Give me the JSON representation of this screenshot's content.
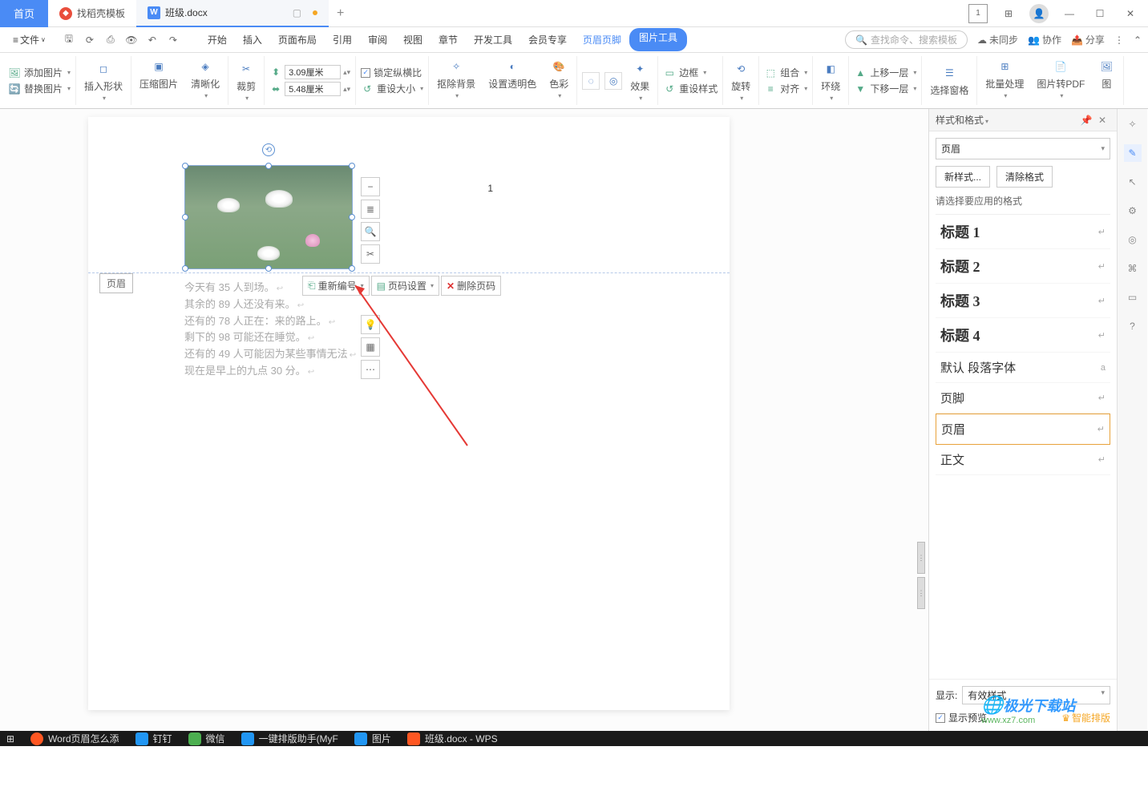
{
  "titlebar": {
    "home": "首页",
    "template": "找稻壳模板",
    "doc": "班级.docx",
    "add": "+"
  },
  "menubar": {
    "file": "文件",
    "tabs": [
      "开始",
      "插入",
      "页面布局",
      "引用",
      "审阅",
      "视图",
      "章节",
      "开发工具",
      "会员专享"
    ],
    "context1": "页眉页脚",
    "context2": "图片工具",
    "search_ph": "查找命令、搜索模板",
    "unsync": "未同步",
    "collab": "协作",
    "share": "分享"
  },
  "ribbon": {
    "add_pic": "添加图片",
    "replace_pic": "替换图片",
    "insert_shape": "插入形状",
    "compress": "压缩图片",
    "clarity": "清晰化",
    "crop": "裁剪",
    "height": "3.09厘米",
    "width": "5.48厘米",
    "lock_ratio": "锁定纵横比",
    "reset_size": "重设大小",
    "remove_bg": "抠除背景",
    "set_transparent": "设置透明色",
    "color": "色彩",
    "effect": "效果",
    "border": "边框",
    "reset_style": "重设样式",
    "rotate": "旋转",
    "group": "组合",
    "align": "对齐",
    "wrap": "环绕",
    "move_up": "上移一层",
    "move_down": "下移一层",
    "sel_pane": "选择窗格",
    "batch": "批量处理",
    "to_pdf": "图片转PDF",
    "pic_trunc": "图"
  },
  "doc": {
    "pagenum": "1",
    "header_label": "页眉",
    "lines": [
      "今天有 35 人到场。",
      "其余的 89 人还没有来。",
      "还有的 78 人正在：来的路上。",
      "剩下的 98 可能还在睡觉。",
      "还有的 49 人可能因为某些事情无法",
      "现在是早上的九点 30 分。"
    ],
    "ctx": {
      "renumber": "重新编号",
      "page_setup": "页码设置",
      "del_num": "删除页码"
    }
  },
  "sidepanel": {
    "title": "样式和格式",
    "current": "页眉",
    "new_style": "新样式...",
    "clear": "清除格式",
    "prompt": "请选择要应用的格式",
    "styles": [
      {
        "name": "标题 1",
        "cls": "h"
      },
      {
        "name": "标题 2",
        "cls": "h"
      },
      {
        "name": "标题 3",
        "cls": "h"
      },
      {
        "name": "标题 4",
        "cls": "h"
      },
      {
        "name": "默认 段落字体",
        "cls": ""
      },
      {
        "name": "页脚",
        "cls": ""
      },
      {
        "name": "页眉",
        "cls": "",
        "sel": true
      },
      {
        "name": "正文",
        "cls": ""
      }
    ],
    "show_label": "显示:",
    "show_value": "有效样式",
    "preview": "显示预览",
    "smart": "智能排版"
  },
  "taskbar": {
    "items": [
      {
        "label": "Word页眉怎么添",
        "color": "#ff5722"
      },
      {
        "label": "钉钉",
        "color": "#2196f3"
      },
      {
        "label": "微信",
        "color": "#4caf50"
      },
      {
        "label": "一键排版助手(MyF",
        "color": "#2196f3"
      },
      {
        "label": "图片",
        "color": "#2196f3"
      },
      {
        "label": "班级.docx - WPS",
        "color": "#ff5722"
      }
    ]
  },
  "watermark": {
    "name": "极光下载站",
    "url": "www.xz7.com"
  }
}
